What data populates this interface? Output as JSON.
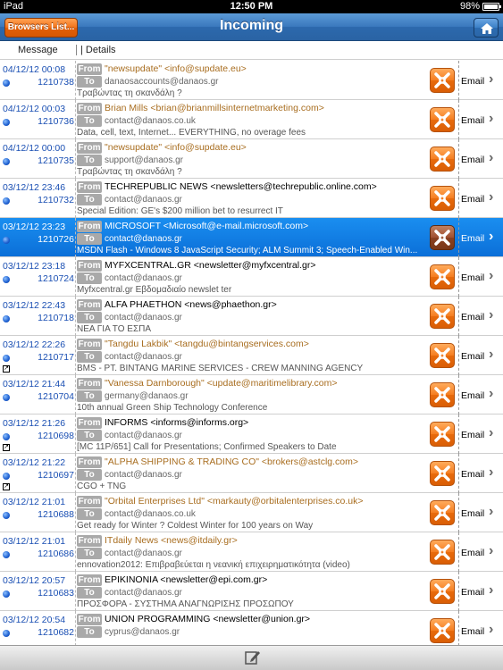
{
  "status": {
    "carrier": "iPad",
    "time": "12:50 PM",
    "battery": "98%"
  },
  "nav": {
    "title": "Incoming",
    "browsers_button": "Browsers List...",
    "home_icon": "home-icon"
  },
  "columns": {
    "message": "Message",
    "details": "| Details"
  },
  "tags": {
    "from": "From",
    "to": "To"
  },
  "action_label": "Email",
  "messages": [
    {
      "date": "04/12/12 00:08",
      "id": "1210738",
      "from": "\"newsupdate\" <info@supdate.eu>",
      "to": "danaosaccounts@danaos.gr",
      "subject": "Τραβώντας τη σκανδάλη ?",
      "from_style": "alt",
      "attach": false,
      "selected": false
    },
    {
      "date": "04/12/12 00:03",
      "id": "1210736",
      "from": "Brian Mills <brian@brianmillsinternetmarketing.com>",
      "to": "contact@danaos.co.uk",
      "subject": "Data, cell, text, Internet... EVERYTHING, no overage fees",
      "from_style": "alt",
      "attach": false,
      "selected": false
    },
    {
      "date": "04/12/12 00:00",
      "id": "1210735",
      "from": "\"newsupdate\" <info@supdate.eu>",
      "to": "support@danaos.gr",
      "subject": "Τραβώντας τη σκανδάλη ?",
      "from_style": "alt",
      "attach": false,
      "selected": false
    },
    {
      "date": "03/12/12 23:46",
      "id": "1210732",
      "from": "TECHREPUBLIC NEWS <newsletters@techrepublic.online.com>",
      "to": "contact@danaos.gr",
      "subject": "Special Edition: GE's $200 million bet to resurrect IT",
      "from_style": "",
      "attach": false,
      "selected": false
    },
    {
      "date": "03/12/12 23:23",
      "id": "1210726",
      "from": "MICROSOFT <Microsoft@e-mail.microsoft.com>",
      "to": "contact@danaos.gr",
      "subject": "MSDN Flash - Windows 8 JavaScript Security; ALM Summit 3; Speech-Enabled Win...",
      "from_style": "",
      "attach": false,
      "selected": true
    },
    {
      "date": "03/12/12 23:18",
      "id": "1210724",
      "from": "MYFXCENTRAL.GR <newsletter@myfxcentral.gr>",
      "to": "contact@danaos.gr",
      "subject": "Myfxcentral.gr Εβδομαδιαίο newslet  ter",
      "from_style": "",
      "attach": false,
      "selected": false
    },
    {
      "date": "03/12/12 22:43",
      "id": "1210718",
      "from": "ALFA PHAETHON <news@phaethon.gr>",
      "to": "contact@danaos.gr",
      "subject": "ΝΕΑ ΓΙΑ ΤΟ ΕΣΠΑ",
      "from_style": "",
      "attach": false,
      "selected": false
    },
    {
      "date": "03/12/12 22:26",
      "id": "1210717",
      "from": "\"Tangdu Lakbik\" <tangdu@bintangservices.com>",
      "to": "contact@danaos.gr",
      "subject": "BMS - PT. BINTANG MARINE SERVICES - CREW MANNING AGENCY",
      "from_style": "alt",
      "attach": true,
      "selected": false
    },
    {
      "date": "03/12/12 21:44",
      "id": "1210704",
      "from": "\"Vanessa Darnborough\" <update@maritimelibrary.com>",
      "to": "germany@danaos.gr",
      "subject": "10th annual Green Ship Technology Conference",
      "from_style": "alt",
      "attach": false,
      "selected": false
    },
    {
      "date": "03/12/12 21:26",
      "id": "1210698",
      "from": "INFORMS <informs@informs.org>",
      "to": "contact@danaos.gr",
      "subject": "[MC 11P/651] Call for Presentations; Confirmed Speakers to Date",
      "from_style": "",
      "attach": true,
      "selected": false
    },
    {
      "date": "03/12/12 21:22",
      "id": "1210697",
      "from": "\"ALPHA SHIPPING & TRADING CO\" <brokers@astclg.com>",
      "to": "contact@danaos.gr",
      "subject": "CGO + TNG",
      "from_style": "alt",
      "attach": true,
      "selected": false
    },
    {
      "date": "03/12/12 21:01",
      "id": "1210688",
      "from": "\"Orbital Enterprises Ltd\" <markauty@orbitalenterprises.co.uk>",
      "to": "contact@danaos.co.uk",
      "subject": "Get ready for Winter ? Coldest Winter for 100 years on Way",
      "from_style": "alt",
      "attach": false,
      "selected": false
    },
    {
      "date": "03/12/12 21:01",
      "id": "1210686",
      "from": "ITdaily News <news@itdaily.gr>",
      "to": "contact@danaos.gr",
      "subject": "ennovation2012: Επιβραβεύεται η νεανική επιχειρηματικότητα (video)",
      "from_style": "alt",
      "attach": false,
      "selected": false
    },
    {
      "date": "03/12/12 20:57",
      "id": "1210683",
      "from": "EPIKINONIA <newsletter@epi.com.gr>",
      "to": "contact@danaos.gr",
      "subject": "ΠΡΟΣΦΟΡΑ - ΣΥΣΤΗΜΑ ΑΝΑΓΝΩΡΙΣΗΣ ΠΡΟΣΩΠΟΥ",
      "from_style": "",
      "attach": false,
      "selected": false
    },
    {
      "date": "03/12/12 20:54",
      "id": "1210682",
      "from": "UNION PROGRAMMING <newsletter@union.gr>",
      "to": "cyprus@danaos.gr",
      "subject": "",
      "from_style": "",
      "attach": false,
      "selected": false
    }
  ]
}
